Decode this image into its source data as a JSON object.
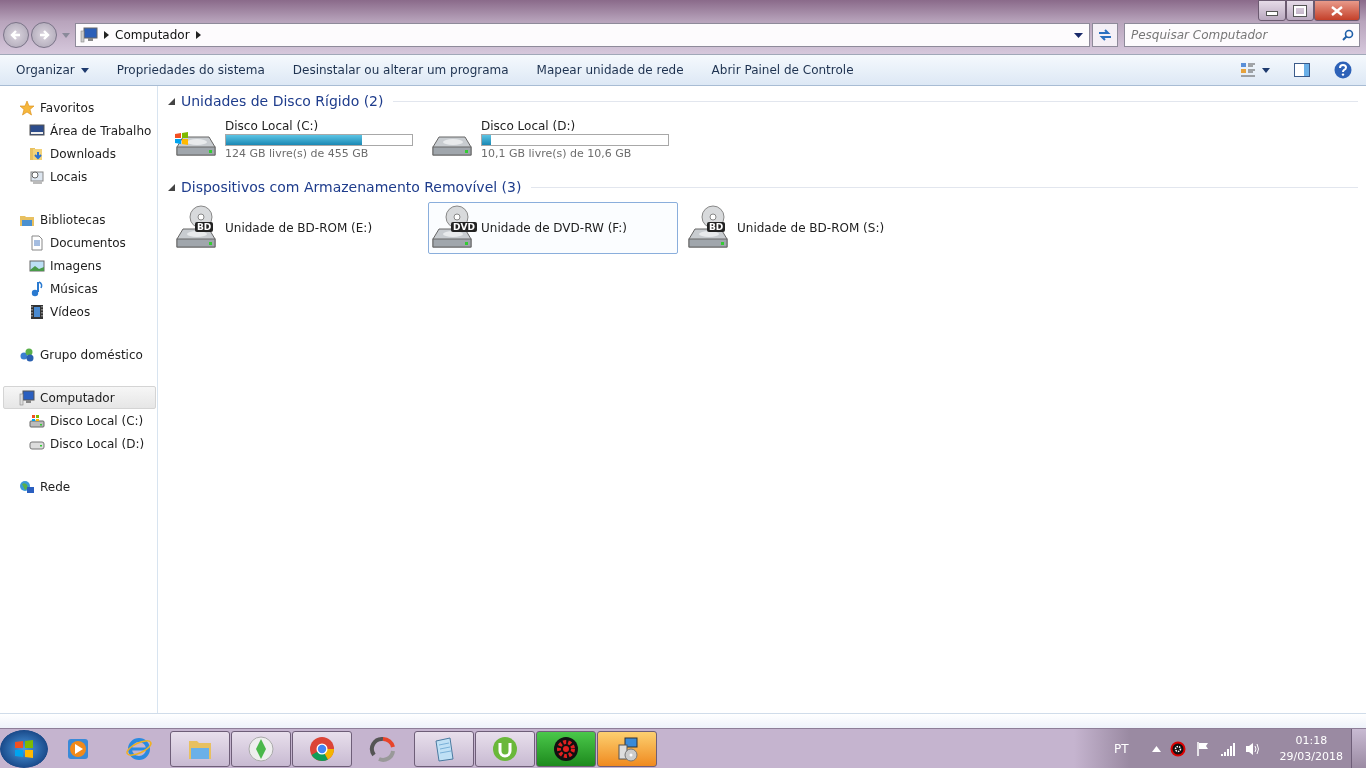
{
  "address": {
    "crumbs": [
      "Computador"
    ]
  },
  "search": {
    "placeholder": "Pesquisar Computador"
  },
  "toolbar": {
    "items": [
      {
        "label": "Organizar",
        "dropdown": true
      },
      {
        "label": "Propriedades do sistema",
        "dropdown": false
      },
      {
        "label": "Desinstalar ou alterar um programa",
        "dropdown": false
      },
      {
        "label": "Mapear unidade de rede",
        "dropdown": false
      },
      {
        "label": "Abrir Painel de Controle",
        "dropdown": false
      }
    ]
  },
  "sidebar": {
    "groups": [
      {
        "label": "Favoritos",
        "selected": false,
        "children": [
          {
            "label": "Área de Trabalho",
            "selected": false
          },
          {
            "label": "Downloads",
            "selected": false
          },
          {
            "label": "Locais",
            "selected": false
          }
        ]
      },
      {
        "label": "Bibliotecas",
        "selected": false,
        "children": [
          {
            "label": "Documentos",
            "selected": false
          },
          {
            "label": "Imagens",
            "selected": false
          },
          {
            "label": "Músicas",
            "selected": false
          },
          {
            "label": "Vídeos",
            "selected": false
          }
        ]
      },
      {
        "label": "Grupo doméstico",
        "selected": false
      },
      {
        "label": "Computador",
        "selected": true,
        "children": [
          {
            "label": "Disco Local (C:)",
            "selected": false
          },
          {
            "label": "Disco Local (D:)",
            "selected": false
          }
        ]
      },
      {
        "label": "Rede",
        "selected": false
      }
    ]
  },
  "sections": [
    {
      "title": "Unidades de Disco Rígido (2)",
      "expanded": true,
      "items": [
        {
          "kind": "disk",
          "label": "Disco Local (C:)",
          "level": 0.73,
          "free": "124 GB livre(s) de 455 GB",
          "selected": false
        },
        {
          "kind": "disk",
          "label": "Disco Local (D:)",
          "level": 0.05,
          "free": "10,1 GB livre(s) de 10,6 GB",
          "selected": false
        }
      ]
    },
    {
      "title": "Dispositivos com Armazenamento Removível (3)",
      "expanded": true,
      "items": [
        {
          "kind": "optical",
          "label": "Unidade de BD-ROM (E:)",
          "badge": "BD",
          "selected": false
        },
        {
          "kind": "optical",
          "label": "Unidade de DVD-RW (F:)",
          "badge": "DVD",
          "selected": true
        },
        {
          "kind": "optical",
          "label": "Unidade de BD-ROM (S:)",
          "badge": "BD",
          "selected": false
        }
      ]
    }
  ],
  "taskbar": {
    "apps": [
      {
        "kind": "pinned"
      },
      {
        "kind": "pinned"
      },
      {
        "kind": "running"
      },
      {
        "kind": "running"
      },
      {
        "kind": "running"
      },
      {
        "kind": "pinned"
      },
      {
        "kind": "running"
      },
      {
        "kind": "running"
      },
      {
        "kind": "progress"
      },
      {
        "kind": "alert"
      }
    ],
    "language": "PT",
    "time": "01:18",
    "date": "29/03/2018"
  }
}
